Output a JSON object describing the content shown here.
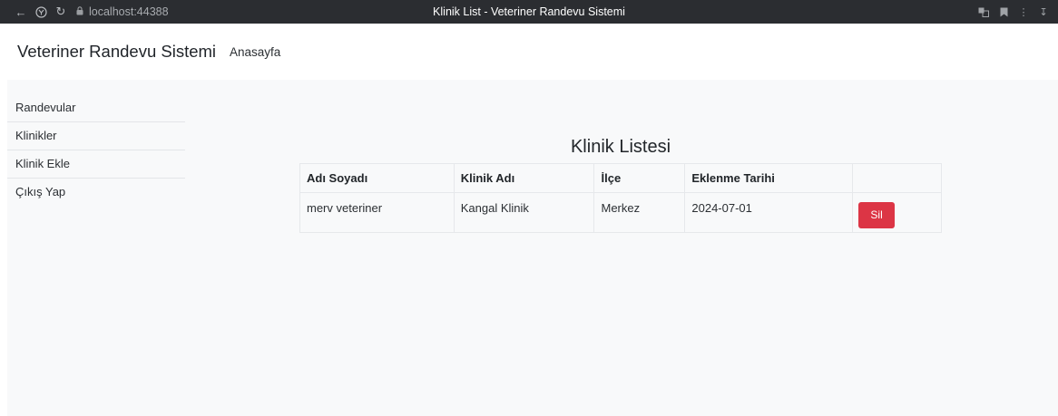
{
  "browser": {
    "url": "localhost:44388",
    "tab_title": "Klinik List - Veteriner Randevu Sistemi"
  },
  "header": {
    "brand": "Veteriner Randevu Sistemi",
    "home_link": "Anasayfa"
  },
  "sidebar": {
    "items": [
      {
        "label": "Randevular"
      },
      {
        "label": "Klinikler"
      },
      {
        "label": "Klinik Ekle"
      },
      {
        "label": "Çıkış Yap"
      }
    ]
  },
  "main": {
    "title": "Klinik Listesi",
    "table": {
      "headers": [
        "Adı Soyadı",
        "Klinik Adı",
        "İlçe",
        "Eklenme Tarihi",
        ""
      ],
      "rows": [
        {
          "name": "merv veteriner",
          "clinic": "Kangal Klinik",
          "ilce": "Merkez",
          "date": "2024-07-01",
          "action": "Sil"
        }
      ]
    }
  },
  "colors": {
    "chrome_bg": "#2b2d31",
    "content_bg": "#f8f9fa",
    "danger": "#dc3545"
  }
}
